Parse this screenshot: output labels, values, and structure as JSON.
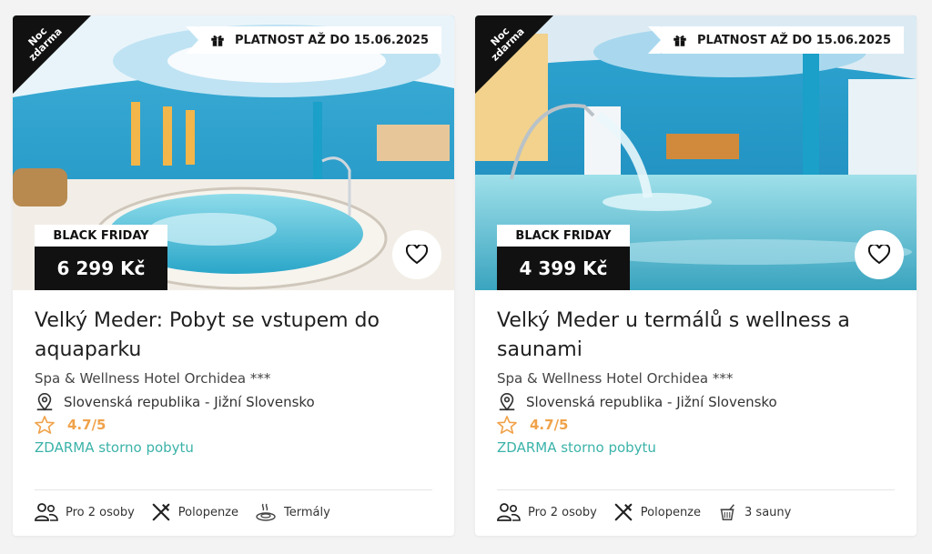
{
  "cards": [
    {
      "corner_label": "Noc zdarma",
      "validity": "PLATNOST AŽ DO 15.06.2025",
      "badge": "BLACK FRIDAY",
      "price": "6 299 Kč",
      "title": "Velký Meder: Pobyt se vstupem do aquaparku",
      "hotel": "Spa & Wellness Hotel Orchidea ***",
      "location": "Slovenská republika - Jižní Slovensko",
      "rating": "4.7/5",
      "storno": "ZDARMA storno pobytu",
      "amenities": [
        "Pro 2 osoby",
        "Polopenze",
        "Termály"
      ]
    },
    {
      "corner_label": "Noc zdarma",
      "validity": "PLATNOST AŽ DO 15.06.2025",
      "badge": "BLACK FRIDAY",
      "price": "4 399 Kč",
      "title": "Velký Meder u termálů s wellness a saunami",
      "hotel": "Spa & Wellness Hotel Orchidea ***",
      "location": "Slovenská republika - Jižní Slovensko",
      "rating": "4.7/5",
      "storno": "ZDARMA storno pobytu",
      "amenities": [
        "Pro 2 osoby",
        "Polopenze",
        "3 sauny"
      ]
    }
  ],
  "icons": {
    "corner": "ribbon",
    "validity": "gift-icon",
    "favorite": "heart-icon",
    "location": "map-pin-icon",
    "rating": "star-icon",
    "amenities_card1": [
      "people-icon",
      "fork-knife-icon",
      "thermal-spa-icon"
    ],
    "amenities_card2": [
      "people-icon",
      "fork-knife-icon",
      "sauna-bucket-icon"
    ]
  },
  "colors": {
    "accent_teal": "#3bb3a9",
    "rating_orange": "#f0a24a",
    "badge_black": "#111111"
  }
}
